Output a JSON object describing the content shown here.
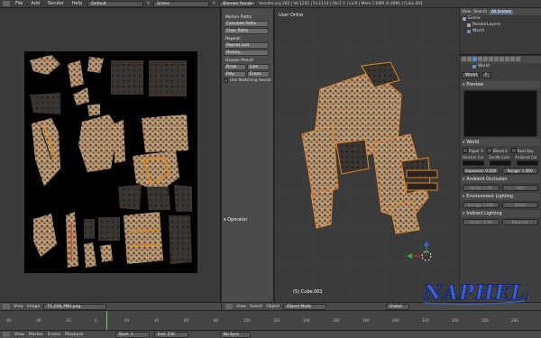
{
  "topbar": {
    "menus": [
      "File",
      "Add",
      "Render",
      "Help"
    ],
    "layout": "Default",
    "scene": "Scene",
    "engine": "Blender Render",
    "stats": "blender.org 262 | Ve:1262 | Fa:1114 | Ob:1-1 | La:0 | Mem:7.69M (4.48M) | Cube.001"
  },
  "toolshelf": {
    "motion_paths_label": "Motion Paths",
    "calculate_paths": "Calculate Paths",
    "clear_paths": "Clear Paths",
    "repeat_label": "Repeat:",
    "repeat_last": "Repeat Last",
    "history": "History...",
    "grease_label": "Grease Pencil:",
    "draw": "Draw",
    "line": "Line",
    "poly": "Poly",
    "erase": "Erase",
    "use_sketching": "Use Sketching Sessio",
    "operator": "Operator"
  },
  "viewport": {
    "title": "User Ortho",
    "object_label": "(5) Cube.001"
  },
  "outliner": {
    "tabs": [
      "View",
      "Search",
      "All Scenes"
    ],
    "items": [
      "Scene",
      "RenderLayers",
      "World"
    ]
  },
  "properties": {
    "world_label": "World",
    "world_field": "World",
    "world_f": "F",
    "preview_label": "Preview",
    "world_section": "World",
    "paper_sky": "Paper S",
    "blend_sky": "Blend S",
    "real_sky": "Real Sky",
    "horizon_label": "Horizon Col",
    "zenith_label": "Zenith Colo",
    "ambient_label": "Ambient Col",
    "exposure": "Exposure: 0.000",
    "range": "Range: 1.000",
    "ambient_occlusion": "Ambient Occlusion",
    "ao_factor": "Factor: 1.00",
    "ao_mode": "Add",
    "environment_lighting": "Environment Lighting",
    "env_energy": "Energy: 1.000",
    "env_color": "White",
    "indirect_lighting": "Indirect Lighting",
    "ind_factor": "Factor: 1.00",
    "bounces": "Bounces"
  },
  "image_header": {
    "menus": [
      "View",
      "Image"
    ],
    "image_name": "TX_038_PNG.png"
  },
  "viewport_header": {
    "menus": [
      "View",
      "Select",
      "Object"
    ],
    "mode": "Object Mode",
    "orientation": "Global"
  },
  "timeline": {
    "ticks": [
      "-60",
      "-40",
      "-20",
      "0",
      "20",
      "40",
      "60",
      "80",
      "100",
      "120",
      "140",
      "160",
      "180",
      "200",
      "220",
      "240",
      "260",
      "280"
    ],
    "menus": [
      "View",
      "Marker",
      "Frame",
      "Playback"
    ],
    "start": "Start: 1",
    "end": "End: 250",
    "sync": "No Sync"
  },
  "logo_text": "NAPHELIA",
  "colors": {
    "accent": "#5a88c8",
    "current_frame": "#6fd16f",
    "grid_red": "#a33",
    "grid_green": "#3a3"
  }
}
